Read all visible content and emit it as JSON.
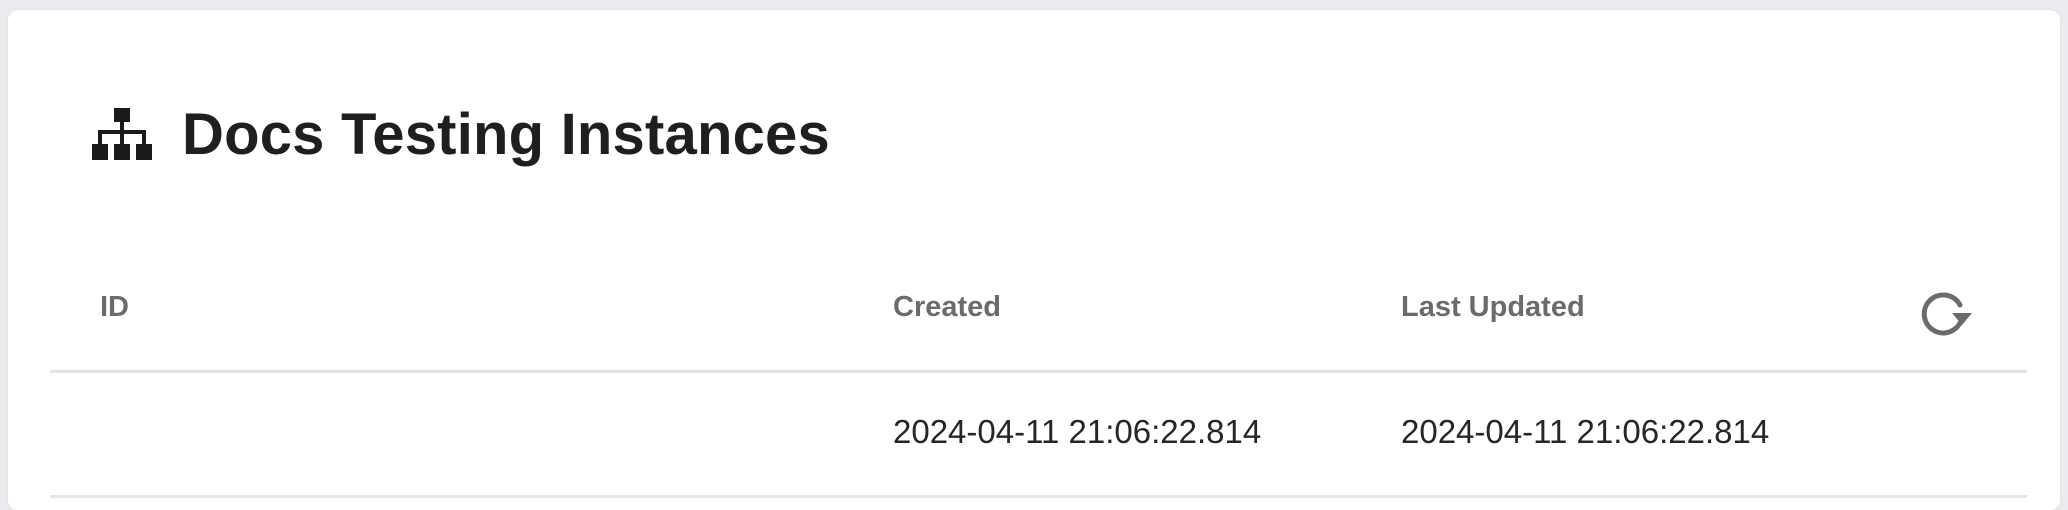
{
  "page": {
    "title": "Docs Testing Instances",
    "title_icon": "sitemap-icon"
  },
  "table": {
    "columns": [
      "ID",
      "Created",
      "Last Updated"
    ],
    "refresh_icon": "refresh-icon",
    "rows": [
      {
        "id": "",
        "created": "2024-04-11 21:06:22.814",
        "last_updated": "2024-04-11 21:06:22.814"
      }
    ]
  },
  "colors": {
    "background": "#ebebf0",
    "card": "#ffffff",
    "title_text": "#1f1f1f",
    "header_text": "#6b6b6b",
    "cell_text": "#262626",
    "divider": "#e4e4e8",
    "icon": "#6b6b6b"
  }
}
